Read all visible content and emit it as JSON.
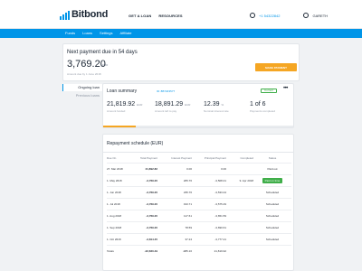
{
  "header": {
    "brand": "Bitbond",
    "nav": [
      "GET A LOAN",
      "RESOURCES"
    ],
    "phone": "+1 54322842",
    "user": "GARETH"
  },
  "subnav": [
    "Funds",
    "Loans",
    "Settings",
    "Affiliate"
  ],
  "payment": {
    "title": "Next payment due in 54 days",
    "amount": "3,769.20",
    "currency": "EUR",
    "note": "Amount due by 1 June 2018",
    "button": "MAKE PAYMENT"
  },
  "sidebar": [
    "Ongoing loan",
    "Previous loans"
  ],
  "summary": {
    "title": "Loan summary",
    "loan_id": "ID: 8B74F3577",
    "badge": "Current",
    "more": "•••",
    "stats": [
      {
        "value": "21,819.92",
        "currency": "EUR",
        "label": "Amount funded"
      },
      {
        "value": "18,891.29",
        "currency": "EUR",
        "label": "Amount left to pay"
      },
      {
        "value": "12.39",
        "currency": "%",
        "label": "Nominal interest rate"
      },
      {
        "value": "1 of 6",
        "currency": "",
        "label": "Payments completed"
      }
    ],
    "progress": 0.17
  },
  "schedule": {
    "title": "Repayment schedule (EUR)",
    "columns": [
      "Due On",
      "Total Payment",
      "Interest Payment",
      "Principal Payment",
      "Completed",
      "Status"
    ],
    "rows": [
      [
        "27. Mar 2018",
        "21,892.82",
        "0.00",
        "0.00",
        "",
        "Paid out"
      ],
      [
        "1. May 2018",
        "-3,769.20",
        "265.76",
        "-3,508.41",
        "9. Apr 2018",
        "Paid on time"
      ],
      [
        "1. Jun 2018",
        "-3,769.20",
        "235.76",
        "-3,533.44",
        "",
        "Scheduled"
      ],
      [
        "1. Jul 2018",
        "-3,769.20",
        "193.71",
        "-3,575.49",
        "",
        "Scheduled"
      ],
      [
        "1. Aug 2018",
        "-3,769.20",
        "117.61",
        "-3,651.59",
        "",
        "Scheduled"
      ],
      [
        "1. Sep 2018",
        "-3,769.20",
        "78.59",
        "-3,690.61",
        "",
        "Scheduled"
      ],
      [
        "1. Oct 2018",
        "-3,814.45",
        "37.24",
        "-3,777.21",
        "",
        "Scheduled"
      ]
    ],
    "totals": [
      "Totals",
      "-22,660.49",
      "-985.16",
      "21,819.92",
      "",
      ""
    ]
  },
  "colors": {
    "brand": "#0095e8",
    "accent": "#f5a623",
    "success": "#3fae49"
  },
  "icons": [
    "logo-bars-icon",
    "phone-icon",
    "user-avatar-icon",
    "more-options-icon"
  ]
}
